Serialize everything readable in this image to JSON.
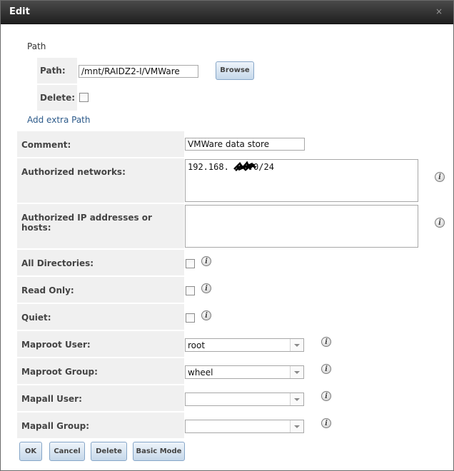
{
  "window": {
    "title": "Edit",
    "close_glyph": "×"
  },
  "path_section": {
    "heading": "Path",
    "path_label": "Path:",
    "path_value": "/mnt/RAIDZ2-I/VMWare",
    "browse_label": "Browse",
    "delete_label": "Delete:",
    "add_extra_path": "Add extra Path"
  },
  "fields": {
    "comment": {
      "label": "Comment:",
      "value": "VMWare data store"
    },
    "authorized_networks": {
      "label": "Authorized networks:",
      "value_prefix": "192.168.",
      "value_suffix": ".0/24"
    },
    "authorized_hosts": {
      "label": "Authorized IP addresses or hosts:",
      "value": ""
    },
    "all_directories": {
      "label": "All Directories:",
      "checked": false
    },
    "read_only": {
      "label": "Read Only:",
      "checked": false
    },
    "quiet": {
      "label": "Quiet:",
      "checked": false
    },
    "maproot_user": {
      "label": "Maproot User:",
      "value": "root"
    },
    "maproot_group": {
      "label": "Maproot Group:",
      "value": "wheel"
    },
    "mapall_user": {
      "label": "Mapall User:",
      "value": ""
    },
    "mapall_group": {
      "label": "Mapall Group:",
      "value": ""
    }
  },
  "info_icon_glyph": "i",
  "buttons": {
    "ok": "OK",
    "cancel": "Cancel",
    "delete": "Delete",
    "basic_mode": "Basic Mode"
  },
  "colors": {
    "titlebar": "#2e2e2e",
    "label_bg": "#f0f0f0",
    "link": "#2c5a8a",
    "button_border": "#86a6c8"
  }
}
